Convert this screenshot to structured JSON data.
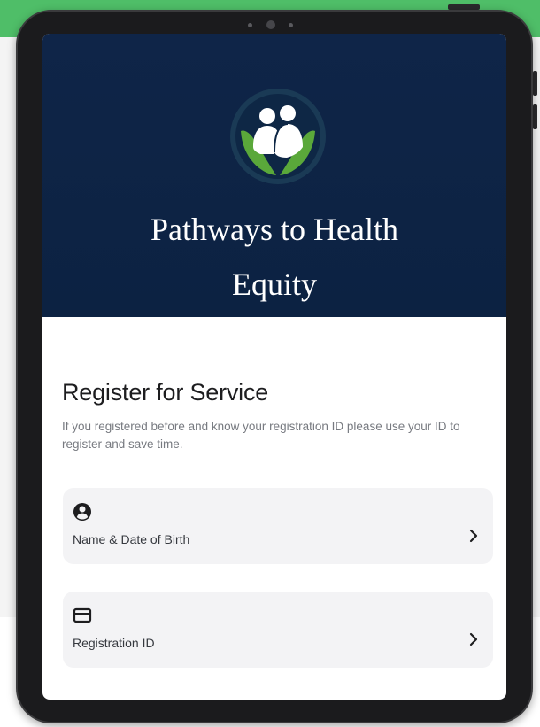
{
  "app": {
    "title_line1": "Pathways to Health",
    "title_line2": "Equity"
  },
  "register": {
    "title": "Register for Service",
    "description": "If you registered before and know your registration ID please use your ID to register and save time."
  },
  "options": [
    {
      "label": "Name & Date of Birth",
      "icon": "user-circle-icon"
    },
    {
      "label": "Registration ID",
      "icon": "id-card-icon"
    }
  ],
  "colors": {
    "hero_background": "#0f2548",
    "logo_green": "#5aa83a",
    "page_green": "#4fbe68"
  }
}
